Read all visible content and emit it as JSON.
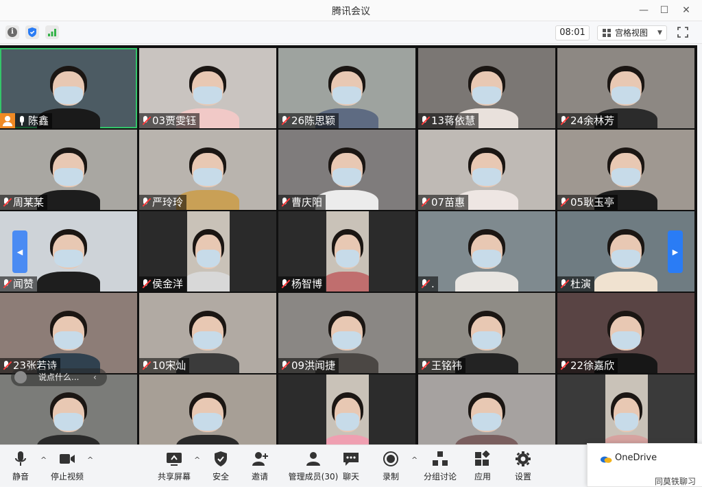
{
  "window": {
    "title": "腾讯会议",
    "minimize": "—",
    "maximize": "☐",
    "close": "✕"
  },
  "topbar": {
    "info_icon": "info-icon",
    "shield_icon": "shield-icon",
    "signal_icon": "signal-icon",
    "timer": "08:01",
    "view_mode": "宫格视图",
    "view_arrow": "▼",
    "fullscreen_icon": "fullscreen-icon"
  },
  "participants": [
    {
      "name": "陈鑫",
      "mic": "on",
      "host": true
    },
    {
      "name": "03贾雯钰",
      "mic": "muted"
    },
    {
      "name": "26陈思颖",
      "mic": "muted"
    },
    {
      "name": "13蒋依慧",
      "mic": "muted"
    },
    {
      "name": "24余林芳",
      "mic": "muted"
    },
    {
      "name": "周某某",
      "mic": "muted"
    },
    {
      "name": "严玲玲",
      "mic": "muted"
    },
    {
      "name": "曹庆阳",
      "mic": "muted"
    },
    {
      "name": "07苗惠",
      "mic": "muted"
    },
    {
      "name": "05耿玉亭",
      "mic": "muted"
    },
    {
      "name": "闻赞",
      "mic": "muted"
    },
    {
      "name": "侯金洋",
      "mic": "muted"
    },
    {
      "name": "杨智博",
      "mic": "muted"
    },
    {
      "name": ".",
      "mic": "muted"
    },
    {
      "name": "杜演",
      "mic": "muted"
    },
    {
      "name": "23张若诗",
      "mic": "muted"
    },
    {
      "name": "10宋灿",
      "mic": "muted"
    },
    {
      "name": "09洪闻捷",
      "mic": "muted"
    },
    {
      "name": "王铭祎",
      "mic": "muted"
    },
    {
      "name": "22徐嘉欣",
      "mic": "muted"
    }
  ],
  "chat_bubble": {
    "text": "说点什么...",
    "arrow": "‹"
  },
  "paging": {
    "left": "◀",
    "right": "▶"
  },
  "toolbar": [
    {
      "label": "静音",
      "icon": "microphone-icon"
    },
    {
      "label": "停止视频",
      "icon": "video-camera-icon"
    },
    {
      "label": "共享屏幕",
      "icon": "share-screen-icon"
    },
    {
      "label": "安全",
      "icon": "security-shield-icon"
    },
    {
      "label": "邀请",
      "icon": "invite-user-icon"
    },
    {
      "label": "管理成员(30)",
      "icon": "manage-members-icon"
    },
    {
      "label": "聊天",
      "icon": "chat-icon"
    },
    {
      "label": "录制",
      "icon": "record-icon"
    },
    {
      "label": "分组讨论",
      "icon": "breakout-rooms-icon"
    },
    {
      "label": "应用",
      "icon": "apps-icon"
    },
    {
      "label": "设置",
      "icon": "settings-gear-icon"
    }
  ],
  "caret": "^",
  "notification": {
    "app": "OneDrive",
    "partial_text": "同莫铁聊习"
  },
  "colors": {
    "active_border": "#34c56a",
    "host_badge": "#f08a24",
    "paging_blue": "#2a7cf5",
    "muted_red": "#ff3b3b"
  }
}
